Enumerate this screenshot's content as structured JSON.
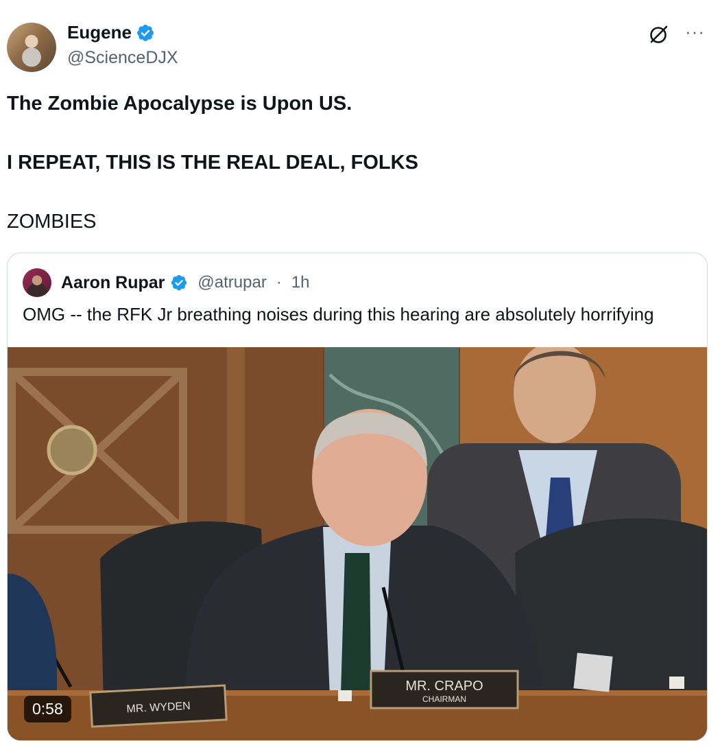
{
  "tweet": {
    "author_name": "Eugene",
    "author_handle": "@ScienceDJX",
    "lines": [
      "The Zombie Apocalypse is Upon US.",
      "I REPEAT, THIS IS THE REAL DEAL, FOLKS",
      "ZOMBIES"
    ]
  },
  "icons": {
    "verified": "verified-badge-icon",
    "grok": "grok-icon",
    "more": "more-options-icon"
  },
  "colors": {
    "verified_blue": "#1d9bf0",
    "secondary_text": "#536471",
    "border": "#cfd9de"
  },
  "quote": {
    "author_name": "Aaron Rupar",
    "author_handle": "@atrupar",
    "separator": "·",
    "time": "1h",
    "text": "OMG -- the RFK Jr breathing noises during this hearing are absolutely horrifying",
    "video": {
      "duration": "0:58",
      "nameplate_left": "MR. WYDEN",
      "nameplate_center": "MR. CRAPO",
      "nameplate_center_sub": "CHAIRMAN"
    }
  }
}
